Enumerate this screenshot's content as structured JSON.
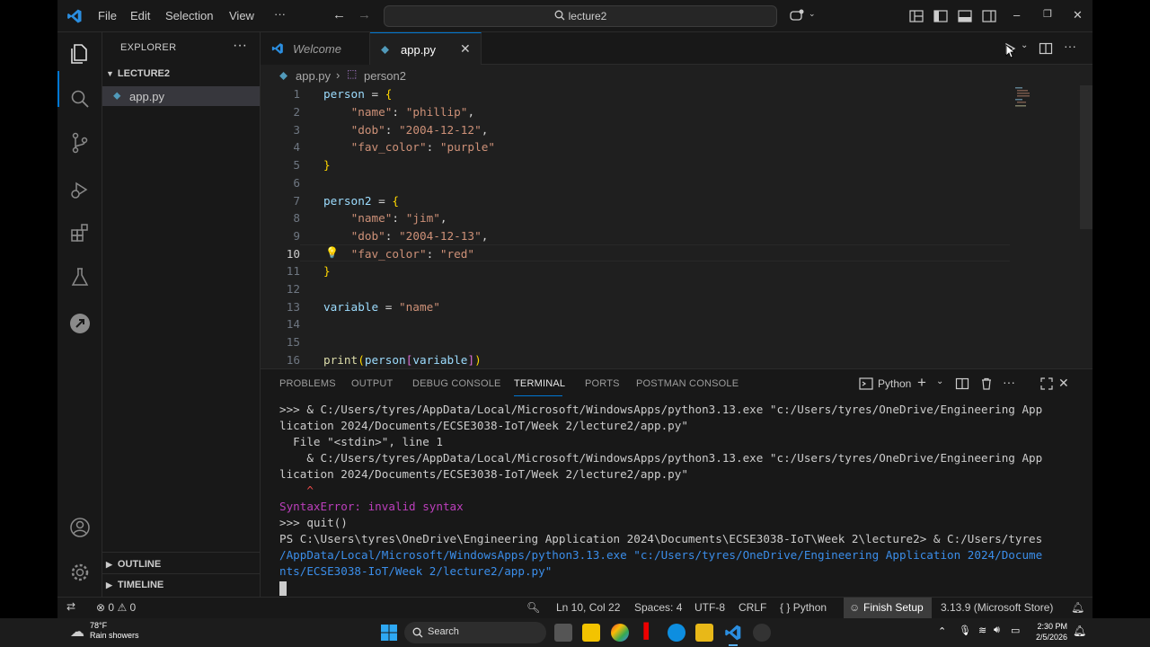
{
  "titlebar": {
    "menu": [
      "File",
      "Edit",
      "Selection",
      "View",
      "···"
    ],
    "search": "lecture2"
  },
  "sidebar": {
    "title": "EXPLORER",
    "folder": "LECTURE2",
    "file": "app.py",
    "outline": "OUTLINE",
    "timeline": "TIMELINE"
  },
  "tabs": [
    {
      "label": "Welcome",
      "active": false
    },
    {
      "label": "app.py",
      "active": true
    }
  ],
  "breadcrumb": {
    "file": "app.py",
    "symbol": "person2"
  },
  "code": {
    "current_line": 10,
    "lines": [
      {
        "n": "1"
      },
      {
        "n": "2"
      },
      {
        "n": "3"
      },
      {
        "n": "4"
      },
      {
        "n": "5"
      },
      {
        "n": "6"
      },
      {
        "n": "7"
      },
      {
        "n": "8"
      },
      {
        "n": "9"
      },
      {
        "n": "10"
      },
      {
        "n": "11"
      },
      {
        "n": "12"
      },
      {
        "n": "13"
      },
      {
        "n": "14"
      },
      {
        "n": "15"
      },
      {
        "n": "16"
      }
    ]
  },
  "panel": {
    "tabs": [
      "PROBLEMS",
      "OUTPUT",
      "DEBUG CONSOLE",
      "TERMINAL",
      "PORTS",
      "POSTMAN CONSOLE"
    ],
    "active_tab": "TERMINAL",
    "shell": "Python",
    "terminal": [
      ">>> & C:/Users/tyres/AppData/Local/Microsoft/WindowsApps/python3.13.exe \"c:/Users/tyres/OneDrive/Engineering App",
      "lication 2024/Documents/ECSE3038-IoT/Week 2/lecture2/app.py\"",
      "  File \"<stdin>\", line 1",
      "    & C:/Users/tyres/AppData/Local/Microsoft/WindowsApps/python3.13.exe \"c:/Users/tyres/OneDrive/Engineering App",
      "lication 2024/Documents/ECSE3038-IoT/Week 2/lecture2/app.py\"",
      "    ^",
      "SyntaxError: invalid syntax",
      ">>> quit()",
      "PS C:\\Users\\tyres\\OneDrive\\Engineering Application 2024\\Documents\\ECSE3038-IoT\\Week 2\\lecture2> & C:/Users/tyres",
      "/AppData/Local/Microsoft/WindowsApps/python3.13.exe \"c:/Users/tyres/OneDrive/Engineering Application 2024/Docume",
      "nts/ECSE3038-IoT/Week 2/lecture2/app.py\""
    ]
  },
  "statusbar": {
    "errors": "0",
    "warnings": "0",
    "position": "Ln 10, Col 22",
    "spaces": "Spaces: 4",
    "encoding": "UTF-8",
    "eol": "CRLF",
    "language": "Python",
    "finish": "Finish Setup",
    "interpreter": "3.13.9 (Microsoft Store)"
  },
  "taskbar": {
    "temp": "78°F",
    "weather": "Rain showers",
    "search": "Search",
    "time": "2:30 PM",
    "date": "2/5/2026"
  }
}
